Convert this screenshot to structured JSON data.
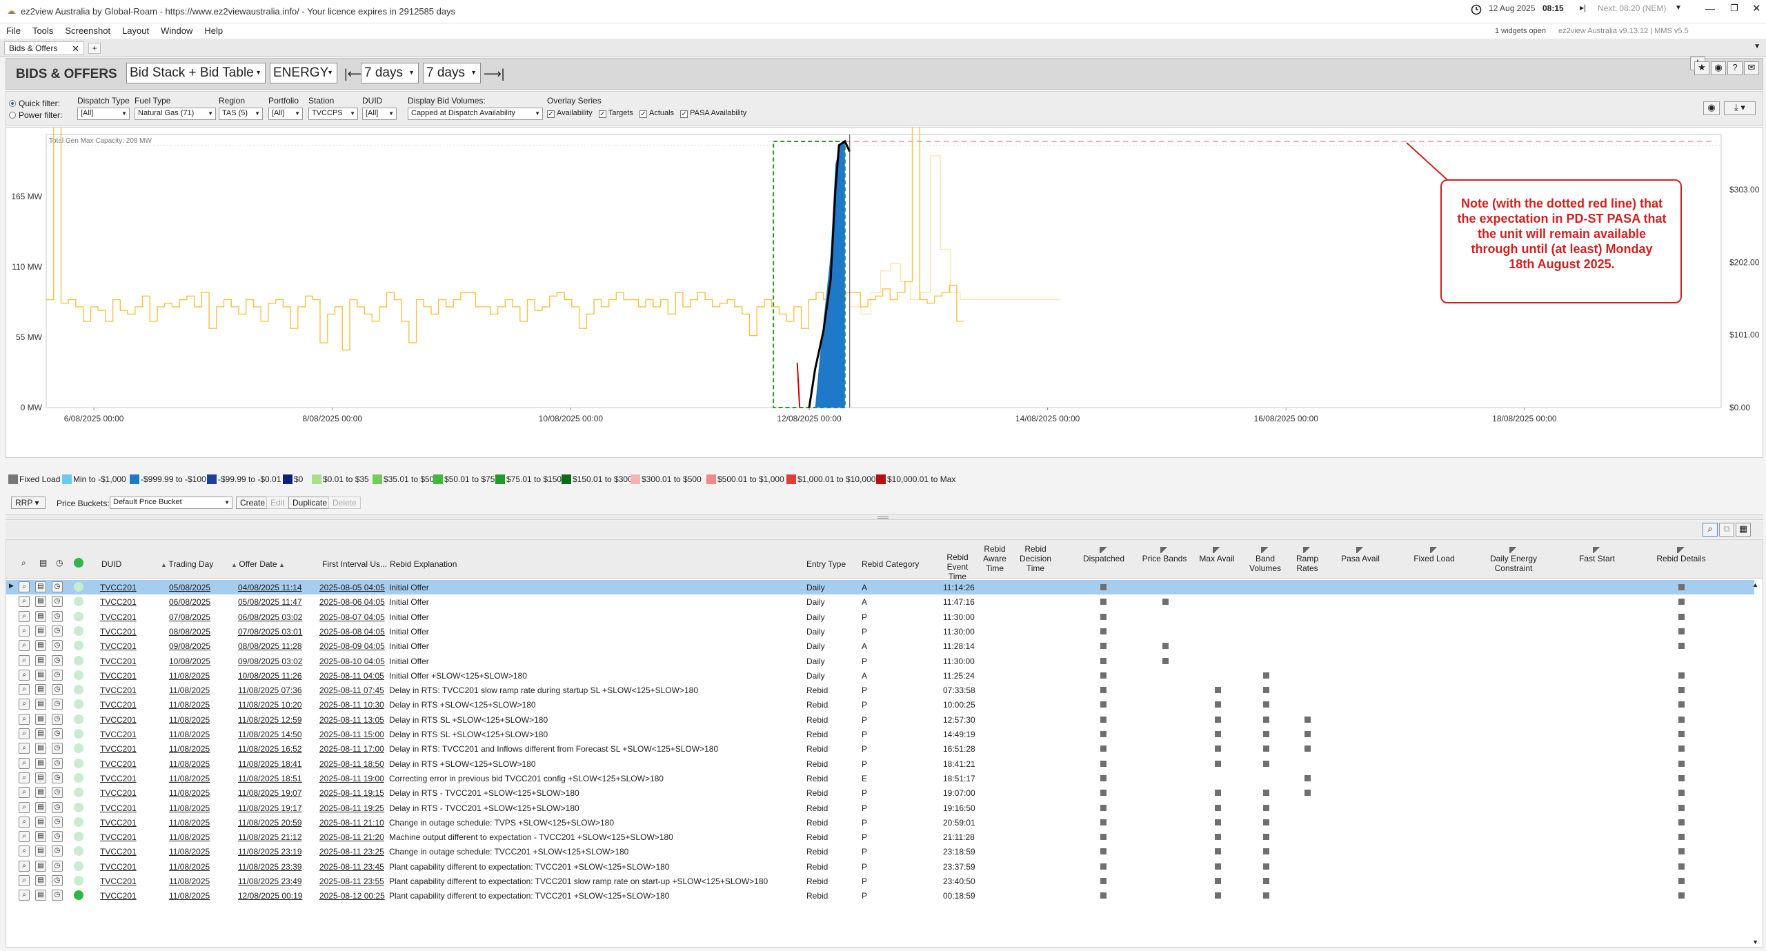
{
  "window": {
    "title": "ez2view Australia by Global-Roam - https://www.ez2viewaustralia.info/ - Your licence expires in 2912585 days",
    "clock_date": "12 Aug 2025",
    "clock_time": "08:15",
    "next_label": "Next: 08:20 (NEM)",
    "widgets_open": "1 widgets open",
    "version": "ez2view Australia v9.13.12 | MMS v5.5"
  },
  "menu": [
    "File",
    "Tools",
    "Screenshot",
    "Layout",
    "Window",
    "Help"
  ],
  "tabs": [
    {
      "label": "Bids & Offers"
    }
  ],
  "toolbar": {
    "heading": "BIDS & OFFERS",
    "view": "Bid Stack + Bid Table",
    "market": "ENERGY",
    "back_range": "7 days",
    "forward_range": "7 days"
  },
  "filters": {
    "quick_filter": "Quick filter:",
    "power_filter": "Power filter:",
    "dispatch_type": {
      "label": "Dispatch Type",
      "value": "[All]"
    },
    "fuel_type": {
      "label": "Fuel Type",
      "value": "Natural Gas (71)"
    },
    "region": {
      "label": "Region",
      "value": "TAS (5)"
    },
    "portfolio": {
      "label": "Portfolio",
      "value": "[All]"
    },
    "station": {
      "label": "Station",
      "value": "TVCCPS"
    },
    "duid": {
      "label": "DUID",
      "value": "[All]"
    },
    "display_bid_volumes": {
      "label": "Display Bid Volumes:",
      "value": "Capped at Dispatch Availability"
    },
    "overlay_series": {
      "label": "Overlay Series",
      "items": [
        "Availability",
        "Targets",
        "Actuals",
        "PASA Availability"
      ]
    }
  },
  "chart_data": {
    "type": "area",
    "capacity_label": "Total Gen Max Capacity: 208 MW",
    "y_ticks": [
      "0 MW",
      "55 MW",
      "110 MW",
      "165 MW"
    ],
    "y_ticks_values": [
      0,
      55,
      110,
      165
    ],
    "y2_ticks": [
      "$0.00",
      "$101.00",
      "$202.00",
      "$303.00"
    ],
    "y2_ticks_values": [
      0,
      101,
      202,
      303
    ],
    "x_ticks": [
      "6/08/2025 00:00",
      "8/08/2025 00:00",
      "10/08/2025 00:00",
      "12/08/2025 00:00",
      "14/08/2025 00:00",
      "16/08/2025 00:00",
      "18/08/2025 00:00"
    ],
    "x_ticks_days": [
      6,
      8,
      10,
      12,
      14,
      16,
      18
    ],
    "x_range_days": [
      5.6,
      19.65
    ],
    "ylim": [
      0,
      208
    ],
    "y2lim": [
      0,
      370
    ],
    "now_day": 12.34,
    "rrp_series": {
      "color": "#f5c242",
      "step_hours": 2,
      "start_day": 5.6,
      "end_day": 13.3,
      "values": [
        150,
        395,
        145,
        150,
        140,
        120,
        140,
        135,
        120,
        150,
        135,
        130,
        140,
        155,
        120,
        140,
        145,
        140,
        150,
        155,
        140,
        160,
        110,
        140,
        150,
        140,
        130,
        150,
        140,
        120,
        145,
        150,
        140,
        110,
        140,
        155,
        150,
        90,
        130,
        140,
        80,
        150,
        140,
        130,
        120,
        140,
        160,
        150,
        120,
        90,
        150,
        140,
        130,
        150,
        140,
        150,
        160,
        160,
        140,
        140,
        130,
        140,
        150,
        140,
        120,
        150,
        135,
        140,
        155,
        160,
        150,
        140,
        110,
        130,
        150,
        140,
        150,
        160,
        150,
        150,
        140,
        150,
        140,
        150,
        130,
        160,
        140,
        150,
        160,
        150,
        140,
        145,
        150,
        140,
        130,
        100,
        140,
        150,
        140,
        130,
        120,
        140,
        110,
        150,
        160,
        150,
        140,
        150,
        160,
        160,
        140,
        150,
        155,
        165,
        150,
        160,
        175,
        400,
        150,
        145,
        155,
        160,
        170,
        120
      ]
    },
    "rrp_forecast": {
      "color": "#f5c242",
      "step_hours": 2,
      "start_day": 12.35,
      "end_day": 14.1,
      "values": [
        140,
        130,
        160,
        190,
        200,
        175,
        150,
        160,
        350,
        220,
        160,
        150,
        150,
        150,
        150,
        150,
        150,
        150,
        150,
        150,
        150
      ]
    },
    "fixed_load_series": {
      "name": "Fixed Load",
      "color": "#000000",
      "points": [
        [
          12.0,
          0
        ],
        [
          12.05,
          30
        ],
        [
          12.12,
          60
        ],
        [
          12.18,
          100
        ],
        [
          12.22,
          170
        ],
        [
          12.25,
          205
        ],
        [
          12.3,
          208
        ],
        [
          12.34,
          200
        ]
      ]
    },
    "availability_series": {
      "color": "#d40000",
      "points": [
        [
          11.9,
          35
        ],
        [
          11.92,
          0
        ]
      ]
    },
    "dispatched_area": {
      "name": "-$999.99 to -$100",
      "color": "#1f79c9",
      "points": [
        [
          12.05,
          0
        ],
        [
          12.1,
          50
        ],
        [
          12.18,
          120
        ],
        [
          12.22,
          190
        ],
        [
          12.26,
          205
        ],
        [
          12.3,
          208
        ],
        [
          12.3,
          0
        ]
      ]
    },
    "pasa_availability": {
      "color": "#f4aeb4",
      "value": 208,
      "from_day": 12.3,
      "to_day": 19.6
    },
    "green_box": {
      "from_day": 11.7,
      "to_day": 12.3,
      "value": 208
    },
    "annotation": "Note (with the dotted red line) that the expectation in PD-ST PASA that the unit will remain available through until (at least) Monday 18th August 2025."
  },
  "legend": [
    {
      "label": "Fixed Load",
      "color": "#777777"
    },
    {
      "label": "Min to -$1,000",
      "color": "#6fc9ec"
    },
    {
      "label": "-$999.99 to -$100",
      "color": "#1f79c9"
    },
    {
      "label": "-$99.99 to -$0.01",
      "color": "#1b3f9a"
    },
    {
      "label": "$0",
      "color": "#10207a"
    },
    {
      "label": "$0.01 to $35",
      "color": "#a8e08a"
    },
    {
      "label": "$35.01 to $50",
      "color": "#6ccf5a"
    },
    {
      "label": "$50.01 to $75",
      "color": "#3fb83b"
    },
    {
      "label": "$75.01 to $150",
      "color": "#1f9c28"
    },
    {
      "label": "$150.01 to $300",
      "color": "#0c6b17"
    },
    {
      "label": "$300.01 to $500",
      "color": "#f7b2b2"
    },
    {
      "label": "$500.01 to $1,000",
      "color": "#f08a8a"
    },
    {
      "label": "$1,000.01 to $10,000",
      "color": "#e43b3b"
    },
    {
      "label": "$10,000.01 to Max",
      "color": "#b80f0f"
    }
  ],
  "price_bar": {
    "rrp": "RRP",
    "buckets_label": "Price Buckets:",
    "bucket": "Default Price Bucket",
    "create": "Create",
    "edit": "Edit",
    "duplicate": "Duplicate",
    "delete": "Delete"
  },
  "table": {
    "headers": {
      "duid": "DUID",
      "trading_day": "Trading Day",
      "offer_date": "Offer Date",
      "first_interval": "First Interval Us...",
      "rebid_explanation": "Rebid Explanation",
      "entry_type": "Entry Type",
      "rebid_category": "Rebid Category",
      "rebid_event_time": "Rebid Event Time",
      "rebid_aware_time": "Rebid Aware Time",
      "rebid_decision_time": "Rebid Decision Time",
      "dispatched": "Dispatched",
      "price_bands": "Price Bands",
      "max_avail": "Max Avail",
      "band_volumes": "Band Volumes",
      "ramp_rates": "Ramp Rates",
      "pasa_avail": "Pasa Avail",
      "fixed_load": "Fixed Load",
      "daily_energy": "Daily Energy Constraint",
      "fast_start": "Fast Start",
      "rebid_details": "Rebid Details"
    },
    "rows": [
      {
        "duid": "TVCC201",
        "td": "05/08/2025",
        "od": "04/08/2025 11:14",
        "fi": "2025-08-05 04:05",
        "ex": "Initial Offer",
        "et": "Daily",
        "cat": "A",
        "evt": "11:14:26",
        "flags": [
          1,
          0,
          0,
          0,
          0,
          0,
          1
        ]
      },
      {
        "duid": "TVCC201",
        "td": "06/08/2025",
        "od": "05/08/2025 11:47",
        "fi": "2025-08-06 04:05",
        "ex": "Initial Offer",
        "et": "Daily",
        "cat": "A",
        "evt": "11:47:16",
        "flags": [
          1,
          1,
          0,
          0,
          0,
          0,
          1
        ]
      },
      {
        "duid": "TVCC201",
        "td": "07/08/2025",
        "od": "06/08/2025 03:02",
        "fi": "2025-08-07 04:05",
        "ex": "Initial Offer",
        "et": "Daily",
        "cat": "P",
        "evt": "11:30:00",
        "flags": [
          1,
          0,
          0,
          0,
          0,
          0,
          1
        ]
      },
      {
        "duid": "TVCC201",
        "td": "08/08/2025",
        "od": "07/08/2025 03:01",
        "fi": "2025-08-08 04:05",
        "ex": "Initial Offer",
        "et": "Daily",
        "cat": "P",
        "evt": "11:30:00",
        "flags": [
          1,
          0,
          0,
          0,
          0,
          0,
          1
        ]
      },
      {
        "duid": "TVCC201",
        "td": "09/08/2025",
        "od": "08/08/2025 11:28",
        "fi": "2025-08-09 04:05",
        "ex": "Initial Offer",
        "et": "Daily",
        "cat": "A",
        "evt": "11:28:14",
        "flags": [
          1,
          1,
          0,
          0,
          0,
          0,
          1
        ]
      },
      {
        "duid": "TVCC201",
        "td": "10/08/2025",
        "od": "09/08/2025 03:02",
        "fi": "2025-08-10 04:05",
        "ex": "Initial Offer",
        "et": "Daily",
        "cat": "P",
        "evt": "11:30:00",
        "flags": [
          1,
          1,
          0,
          0,
          0,
          0,
          0
        ]
      },
      {
        "duid": "TVCC201",
        "td": "11/08/2025",
        "od": "10/08/2025 11:26",
        "fi": "2025-08-11 04:05",
        "ex": "Initial Offer +SLOW<125+SLOW>180",
        "et": "Daily",
        "cat": "A",
        "evt": "11:25:24",
        "flags": [
          1,
          0,
          0,
          1,
          0,
          0,
          1
        ]
      },
      {
        "duid": "TVCC201",
        "td": "11/08/2025",
        "od": "11/08/2025 07:36",
        "fi": "2025-08-11 07:45",
        "ex": "Delay in RTS: TVCC201 slow ramp rate during startup SL +SLOW<125+SLOW>180",
        "et": "Rebid",
        "cat": "P",
        "evt": "07:33:58",
        "flags": [
          1,
          0,
          1,
          1,
          0,
          0,
          1
        ]
      },
      {
        "duid": "TVCC201",
        "td": "11/08/2025",
        "od": "11/08/2025 10:20",
        "fi": "2025-08-11 10:30",
        "ex": "Delay in RTS +SLOW<125+SLOW>180",
        "et": "Rebid",
        "cat": "P",
        "evt": "10:00:25",
        "flags": [
          1,
          0,
          1,
          1,
          0,
          0,
          1
        ]
      },
      {
        "duid": "TVCC201",
        "td": "11/08/2025",
        "od": "11/08/2025 12:59",
        "fi": "2025-08-11 13:05",
        "ex": "Delay in RTS SL +SLOW<125+SLOW>180",
        "et": "Rebid",
        "cat": "P",
        "evt": "12:57:30",
        "flags": [
          1,
          0,
          1,
          1,
          1,
          0,
          1
        ]
      },
      {
        "duid": "TVCC201",
        "td": "11/08/2025",
        "od": "11/08/2025 14:50",
        "fi": "2025-08-11 15:00",
        "ex": "Delay in RTS SL +SLOW<125+SLOW>180",
        "et": "Rebid",
        "cat": "P",
        "evt": "14:49:19",
        "flags": [
          1,
          0,
          1,
          1,
          1,
          0,
          1
        ]
      },
      {
        "duid": "TVCC201",
        "td": "11/08/2025",
        "od": "11/08/2025 16:52",
        "fi": "2025-08-11 17:00",
        "ex": "Delay in RTS: TVCC201 and Inflows different from Forecast SL +SLOW<125+SLOW>180",
        "et": "Rebid",
        "cat": "P",
        "evt": "16:51:28",
        "flags": [
          1,
          0,
          1,
          1,
          1,
          0,
          1
        ]
      },
      {
        "duid": "TVCC201",
        "td": "11/08/2025",
        "od": "11/08/2025 18:41",
        "fi": "2025-08-11 18:50",
        "ex": "Delay in RTS +SLOW<125+SLOW>180",
        "et": "Rebid",
        "cat": "P",
        "evt": "18:41:21",
        "flags": [
          1,
          0,
          1,
          1,
          0,
          0,
          1
        ]
      },
      {
        "duid": "TVCC201",
        "td": "11/08/2025",
        "od": "11/08/2025 18:51",
        "fi": "2025-08-11 19:00",
        "ex": "Correcting error in previous bid TVCC201 config +SLOW<125+SLOW>180",
        "et": "Rebid",
        "cat": "E",
        "evt": "18:51:17",
        "flags": [
          1,
          0,
          0,
          0,
          1,
          0,
          1
        ]
      },
      {
        "duid": "TVCC201",
        "td": "11/08/2025",
        "od": "11/08/2025 19:07",
        "fi": "2025-08-11 19:15",
        "ex": "Delay in RTS - TVCC201 +SLOW<125+SLOW>180",
        "et": "Rebid",
        "cat": "P",
        "evt": "19:07:00",
        "flags": [
          1,
          0,
          1,
          1,
          1,
          0,
          1
        ]
      },
      {
        "duid": "TVCC201",
        "td": "11/08/2025",
        "od": "11/08/2025 19:17",
        "fi": "2025-08-11 19:25",
        "ex": "Delay in RTS - TVCC201 +SLOW<125+SLOW>180",
        "et": "Rebid",
        "cat": "P",
        "evt": "19:16:50",
        "flags": [
          1,
          0,
          1,
          1,
          0,
          0,
          1
        ]
      },
      {
        "duid": "TVCC201",
        "td": "11/08/2025",
        "od": "11/08/2025 20:59",
        "fi": "2025-08-11 21:10",
        "ex": "Change in outage schedule: TVPS +SLOW<125+SLOW>180",
        "et": "Rebid",
        "cat": "P",
        "evt": "20:59:01",
        "flags": [
          1,
          0,
          1,
          1,
          0,
          0,
          1
        ]
      },
      {
        "duid": "TVCC201",
        "td": "11/08/2025",
        "od": "11/08/2025 21:12",
        "fi": "2025-08-11 21:20",
        "ex": "Machine output different to expectation - TVCC201 +SLOW<125+SLOW>180",
        "et": "Rebid",
        "cat": "P",
        "evt": "21:11:28",
        "flags": [
          1,
          0,
          1,
          1,
          0,
          0,
          1
        ]
      },
      {
        "duid": "TVCC201",
        "td": "11/08/2025",
        "od": "11/08/2025 23:19",
        "fi": "2025-08-11 23:25",
        "ex": "Change in outage schedule: TVCC201 +SLOW<125+SLOW>180",
        "et": "Rebid",
        "cat": "P",
        "evt": "23:18:59",
        "flags": [
          1,
          0,
          1,
          1,
          0,
          0,
          1
        ]
      },
      {
        "duid": "TVCC201",
        "td": "11/08/2025",
        "od": "11/08/2025 23:39",
        "fi": "2025-08-11 23:45",
        "ex": "Plant capability different to expectation: TVCC201 +SLOW<125+SLOW>180",
        "et": "Rebid",
        "cat": "P",
        "evt": "23:37:59",
        "flags": [
          1,
          0,
          1,
          1,
          0,
          0,
          1
        ]
      },
      {
        "duid": "TVCC201",
        "td": "11/08/2025",
        "od": "11/08/2025 23:49",
        "fi": "2025-08-11 23:55",
        "ex": "Plant capability different to expectation: TVCC201 slow ramp rate on start-up +SLOW<125+SLOW>180",
        "et": "Rebid",
        "cat": "P",
        "evt": "23:40:50",
        "flags": [
          1,
          0,
          1,
          1,
          0,
          0,
          1
        ]
      },
      {
        "duid": "TVCC201",
        "td": "11/08/2025",
        "od": "12/08/2025 00:19",
        "fi": "2025-08-12 00:25",
        "ex": "Plant capability different to expectation: TVCC201 +SLOW<125+SLOW>180",
        "et": "Rebid",
        "cat": "P",
        "evt": "00:18:59",
        "flags": [
          1,
          0,
          1,
          1,
          0,
          0,
          1
        ]
      }
    ]
  }
}
